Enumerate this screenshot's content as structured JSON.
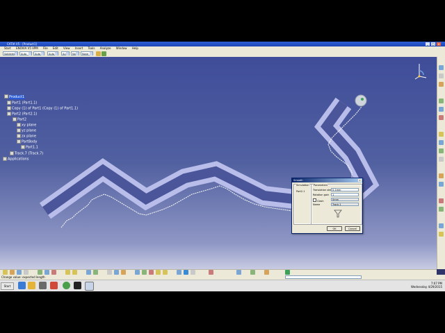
{
  "app": {
    "title": "CATIA V5 - [Product1]",
    "window_controls": {
      "minimize": "_",
      "maximize": "□",
      "close": "x"
    }
  },
  "menu": [
    "Start",
    "ENOVIA V5 VPM",
    "File",
    "Edit",
    "View",
    "Insert",
    "Tools",
    "Analyze",
    "Window",
    "Help"
  ],
  "options_bar": {
    "combos": [
      "Solideleo",
      "Auto",
      "Auto",
      "Auto",
      "Auto",
      "None",
      "None"
    ]
  },
  "tree": {
    "root": "Product1",
    "items": [
      "Part1 (Part1.1)",
      "Copy (1) of Part1 (Copy (1) of Part1.1)",
      "Part2 (Part2.1)",
      "Part2",
      "xy plane",
      "yz plane",
      "zx plane",
      "PartBody",
      "Part1.1",
      "Track.7 (Track.7)",
      "Applications"
    ]
  },
  "dialog": {
    "title": "Smooth",
    "group_left": "Simulation",
    "object_label": "Part2.1",
    "group_right": "Parameters",
    "translation_step_label": "Translation step",
    "translation_step_value": "0.1mm",
    "rotation_gain_label": "Rotation gain",
    "rotation_gain_value": "1",
    "check_label": "Clash",
    "field3_value": "0mm",
    "field4_label": "Name",
    "field4_value": "Track.1",
    "ok": "OK",
    "cancel": "Cancel"
  },
  "status": {
    "prompt": "Change value: expected length"
  },
  "taskbar": {
    "start": "Start",
    "time": "7:07 PM",
    "date": "Wednesday 4/29/2015"
  }
}
